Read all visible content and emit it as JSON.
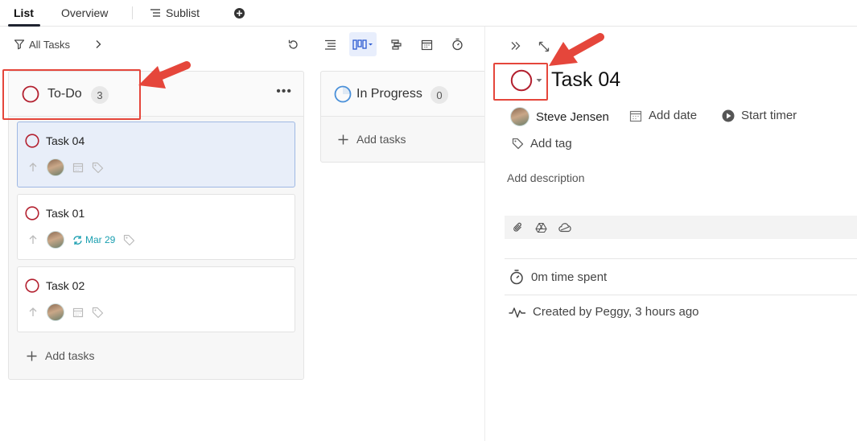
{
  "tabs": [
    {
      "label": "List",
      "active": true
    },
    {
      "label": "Overview",
      "active": false
    },
    {
      "label": "Sublist",
      "active": false
    }
  ],
  "toolbar": {
    "filter_label": "All Tasks"
  },
  "columns": [
    {
      "title": "To-Do",
      "count": "3",
      "status_color": "#b3202f",
      "cards": [
        {
          "title": "Task 04",
          "selected": true,
          "date": ""
        },
        {
          "title": "Task 01",
          "selected": false,
          "date": "Mar 29"
        },
        {
          "title": "Task 02",
          "selected": false,
          "date": ""
        }
      ],
      "add_label": "Add tasks"
    },
    {
      "title": "In Progress",
      "count": "0",
      "status_color": "#4a90d9",
      "add_label": "Add tasks"
    }
  ],
  "detail": {
    "title": "Task 04",
    "assignee": "Steve Jensen",
    "add_date": "Add date",
    "start_timer": "Start timer",
    "add_tag": "Add tag",
    "add_description": "Add description",
    "time_spent": "0m time spent",
    "created_by": "Created by Peggy, 3 hours ago"
  },
  "colors": {
    "todo_status": "#b3202f",
    "accent_blue": "#4a90d9",
    "annotation_red": "#e5463b",
    "recurring_teal": "#1a9fb0"
  }
}
